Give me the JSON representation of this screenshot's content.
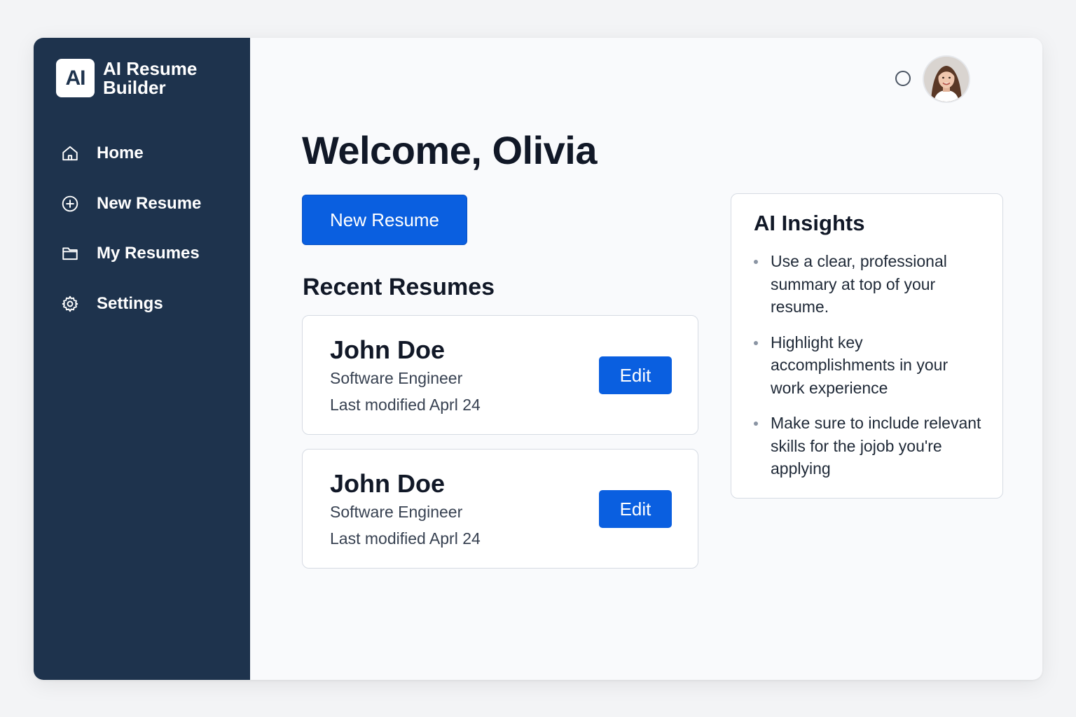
{
  "sidebar": {
    "logo_text": "AI",
    "app_name": "AI Resume Builder",
    "items": [
      {
        "label": "Home",
        "icon": "home-icon"
      },
      {
        "label": "New Resume",
        "icon": "plus-circle-icon"
      },
      {
        "label": "My Resumes",
        "icon": "folder-icon"
      },
      {
        "label": "Settings",
        "icon": "gear-icon"
      }
    ]
  },
  "header": {
    "notification_icon": "circle-icon",
    "avatar": "user-avatar"
  },
  "main": {
    "welcome": "Welcome, Olivia",
    "new_resume_button": "New Resume",
    "recent_title": "Recent Resumes",
    "resumes": [
      {
        "name": "John Doe",
        "role": "Software Engineer",
        "modified": "Last modified Aprl 24",
        "action": "Edit"
      },
      {
        "name": "John Doe",
        "role": "Software Engineer",
        "modified": "Last modified Aprl 24",
        "action": "Edit"
      }
    ]
  },
  "insights": {
    "title": "AI Insights",
    "tips": [
      "Use a clear, professional summary at top of your resume.",
      "Highlight key accomplishments in your work experience",
      "Make sure to include relevant skills for the jojob you're applying"
    ]
  },
  "colors": {
    "sidebar_bg": "#1e334d",
    "accent": "#0a5fe0",
    "page_bg": "#f9fafc"
  }
}
